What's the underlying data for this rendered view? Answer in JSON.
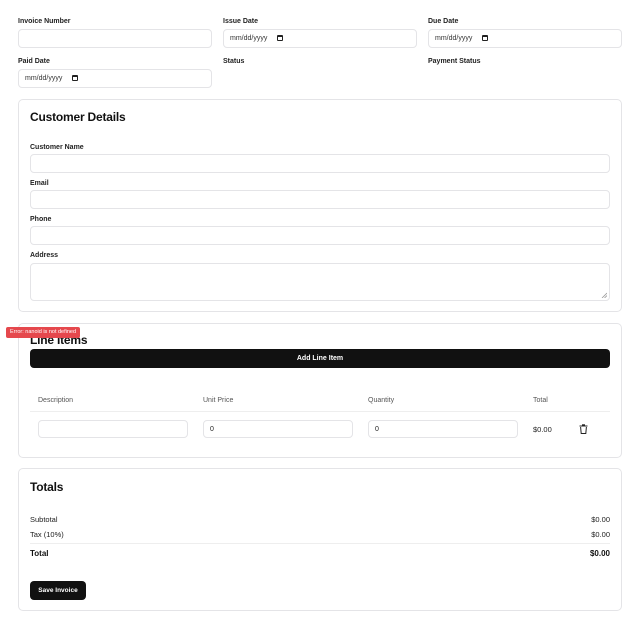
{
  "header": {
    "invoice_number_label": "Invoice Number",
    "issue_date_label": "Issue Date",
    "due_date_label": "Due Date",
    "paid_date_label": "Paid Date",
    "status_label": "Status",
    "payment_status_label": "Payment Status",
    "date_placeholder": "mm/dd/yyyy",
    "invoice_number_value": ""
  },
  "customer": {
    "title": "Customer Details",
    "name_label": "Customer Name",
    "email_label": "Email",
    "phone_label": "Phone",
    "address_label": "Address"
  },
  "line_items": {
    "error": "Error: nanoid is not defined",
    "title": "Line Items",
    "add_button": "Add Line Item",
    "columns": [
      "Description",
      "Unit Price",
      "Quantity",
      "Total"
    ],
    "rows": [
      {
        "description": "",
        "unit_price": "0",
        "quantity": "0",
        "total": "$0.00"
      }
    ]
  },
  "totals": {
    "title": "Totals",
    "subtotal_label": "Subtotal",
    "subtotal_value": "$0.00",
    "tax_label": "Tax (10%)",
    "tax_value": "$0.00",
    "total_label": "Total",
    "total_value": "$0.00",
    "save_button": "Save Invoice"
  },
  "colors": {
    "accent": "#111111",
    "error": "#e5484d",
    "border": "#e4e4e7"
  }
}
